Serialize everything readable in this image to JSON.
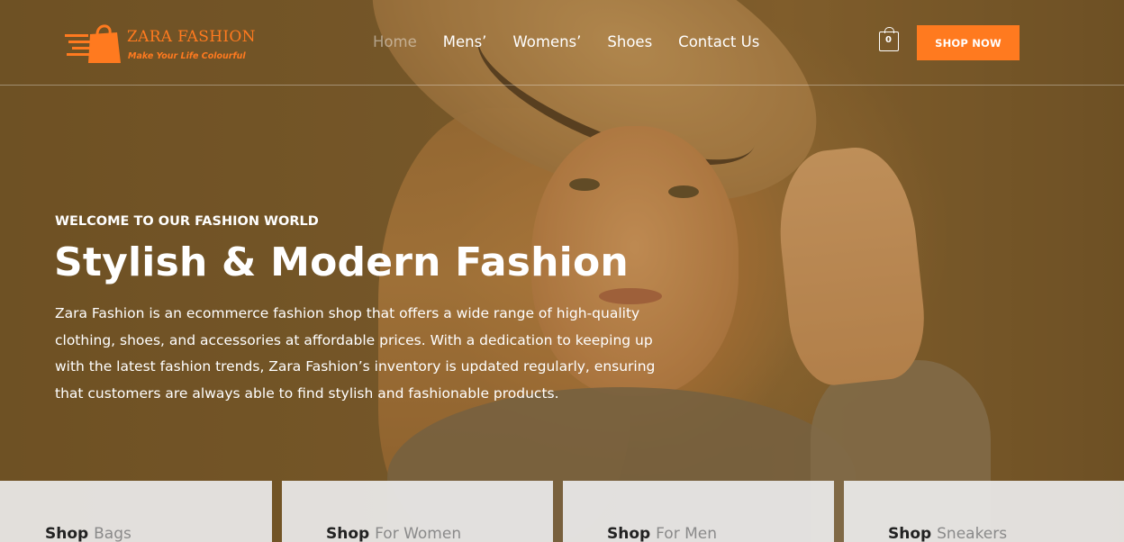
{
  "brand": {
    "name": "ZARA FASHION",
    "tagline": "Make Your Life Colourful",
    "accent_color": "#ff7a1f"
  },
  "nav": {
    "items": [
      {
        "label": "Home",
        "active": true
      },
      {
        "label": "Mens’",
        "active": false
      },
      {
        "label": "Womens’",
        "active": false
      },
      {
        "label": "Shoes",
        "active": false
      },
      {
        "label": "Contact Us",
        "active": false
      }
    ]
  },
  "cart": {
    "count": "0",
    "icon": "shopping-bag-icon"
  },
  "header_button": {
    "label": "SHOP NOW"
  },
  "hero": {
    "eyebrow": "WELCOME TO OUR FASHION WORLD",
    "title": "Stylish & Modern Fashion",
    "description": "Zara Fashion is an ecommerce fashion shop that offers a wide range of high-quality clothing, shoes, and accessories at affordable prices. With a dedication to keeping up with the latest fashion trends, Zara Fashion’s inventory is updated regularly, ensuring that customers are always able to find stylish and fashionable products."
  },
  "categories": [
    {
      "prefix": "Shop",
      "accent": "Bags"
    },
    {
      "prefix": "Shop",
      "accent": "For Women"
    },
    {
      "prefix": "Shop",
      "accent": "For Men"
    },
    {
      "prefix": "Shop",
      "accent": "Sneakers"
    }
  ]
}
